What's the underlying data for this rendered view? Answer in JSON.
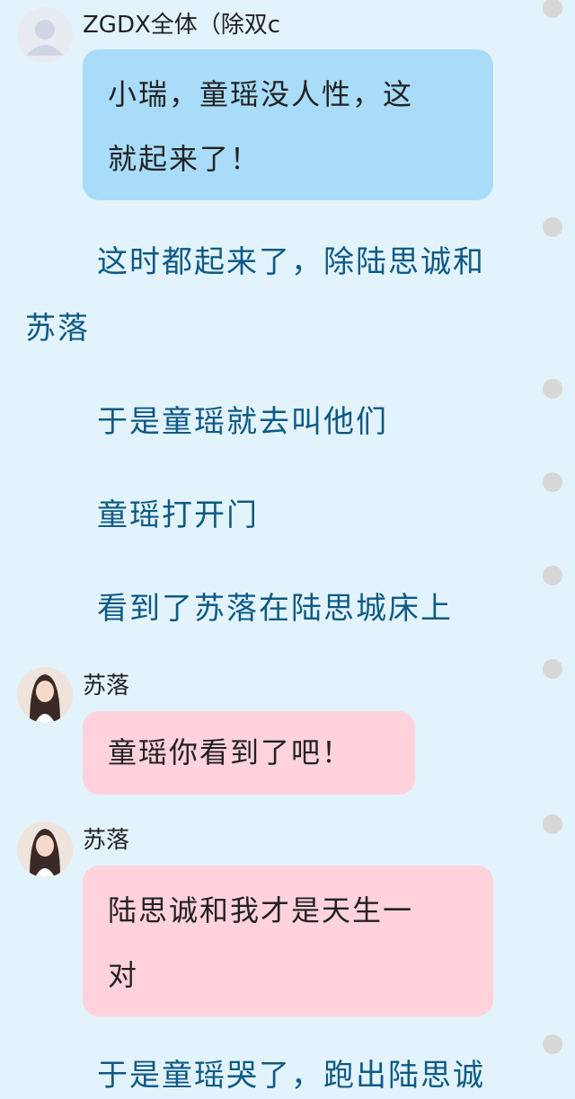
{
  "chat": {
    "messages": [
      {
        "kind": "bubble",
        "sender": "ZGDX全体（除双c",
        "text": "小瑞，童瑶没人性，这就起来了！",
        "style": "blue"
      },
      {
        "kind": "narration",
        "text": "这时都起来了，除陆思诚和苏落"
      },
      {
        "kind": "narration",
        "text": "于是童瑶就去叫他们"
      },
      {
        "kind": "narration",
        "text": "童瑶打开门"
      },
      {
        "kind": "narration",
        "text": "看到了苏落在陆思城床上"
      },
      {
        "kind": "bubble",
        "sender": "苏落",
        "text": "童瑶你看到了吧！",
        "style": "pink"
      },
      {
        "kind": "bubble",
        "sender": "苏落",
        "text": "陆思诚和我才是天生一对",
        "style": "pink"
      },
      {
        "kind": "narration",
        "text": "于是童瑶哭了，跑出陆思诚"
      }
    ],
    "lines": {
      "m0_sender": "ZGDX全体（除双c",
      "m0_line1": "小瑞，童瑶没人性，这",
      "m0_line2": "就起来了！",
      "n1_line1": "这时都起来了，除陆思诚和",
      "n1_line2": "苏落",
      "n2": "于是童瑶就去叫他们",
      "n3": "童瑶打开门",
      "n4": "看到了苏落在陆思城床上",
      "m5_sender": "苏落",
      "m5_text": "童瑶你看到了吧！",
      "m6_sender": "苏落",
      "m6_line1": "陆思诚和我才是天生一",
      "m6_line2": "对",
      "n7": "于是童瑶哭了，跑出陆思诚"
    }
  },
  "colors": {
    "background": "#e3f3fb",
    "bubble_blue": "#a8dcf9",
    "bubble_pink": "#ffd2dc",
    "narration_text": "#0d5a86",
    "dot": "#d7d7d7"
  },
  "icons": {
    "default_avatar": "default-avatar-icon",
    "girl_avatar": "girl-avatar-photo",
    "more_dot": "grey-dot-icon"
  }
}
